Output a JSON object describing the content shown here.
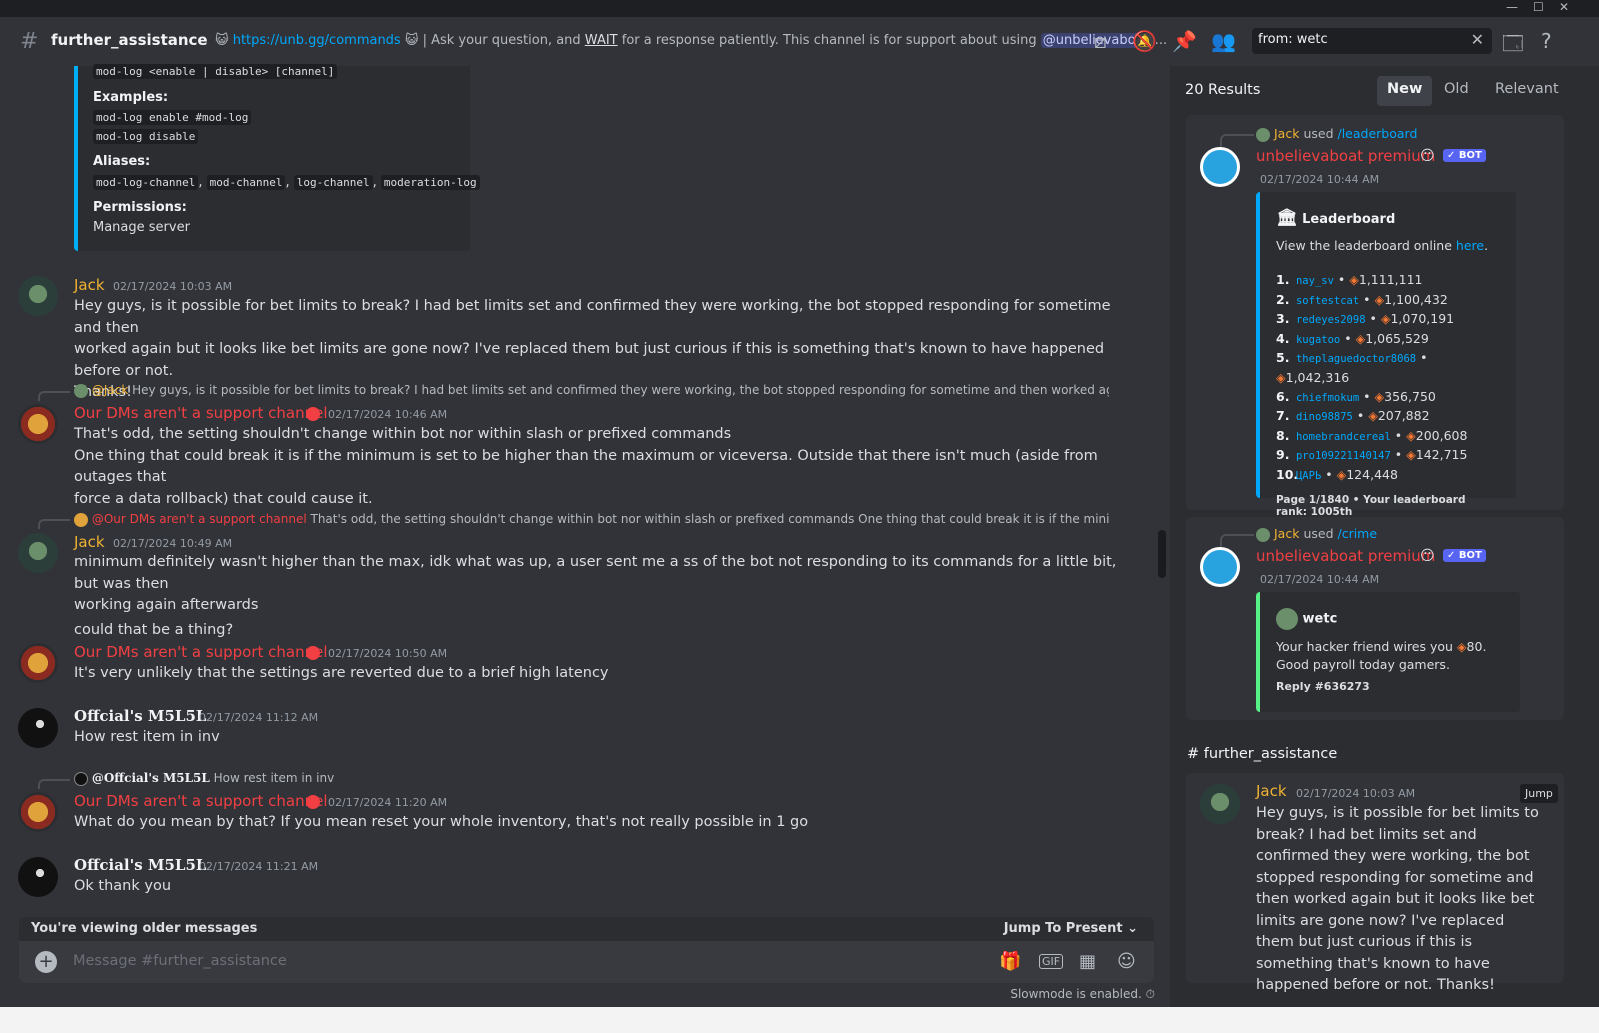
{
  "header": {
    "channel": "further_assistance",
    "topic_link": "https://unb.gg/commands",
    "topic_a": "| Ask your question, and ",
    "topic_wait": "WAIT",
    "topic_b": " for a response patiently. This channel is for support about using ",
    "topic_mention": "@unbelievaboat",
    "topic_more": "...",
    "search_value": "from: wetc"
  },
  "embed_top": {
    "syntax": "mod-log <enable | disable> [channel]",
    "examples_label": "Examples:",
    "example1": "mod-log enable #mod-log",
    "example2": "mod-log disable",
    "aliases_label": "Aliases:",
    "alias1": "mod-log-channel",
    "alias2": "mod-channel",
    "alias3": "log-channel",
    "alias4": "moderation-log",
    "permissions_label": "Permissions:",
    "permissions_value": "Manage server"
  },
  "messages": [
    {
      "author": "Jack",
      "time": "02/17/2024 10:03 AM",
      "text1": "Hey guys, is it possible for bet limits to break? I had bet limits set and confirmed they were working, the bot stopped responding for sometime and then",
      "text2": "worked again but it looks like bet limits are gone now? I've replaced them but just curious if this is something that's known to have happened before or not.",
      "text3": "Thanks!"
    },
    {
      "reply_to": "@Jack",
      "reply_text": "Hey guys, is it possible for bet limits to break? I had bet limits set and confirmed they were working, the bot stopped responding for sometime and then worked again bu",
      "author": "Our DMs aren't a support channel",
      "time": "02/17/2024 10:46 AM",
      "text1": "That's odd, the setting shouldn't change within bot nor within slash or prefixed commands",
      "text2": "One thing that could break it is if the minimum is set to be higher than the maximum or viceversa. Outside that there isn't much (aside from outages that",
      "text3": "force a data rollback) that could cause it."
    },
    {
      "reply_to": "@Our DMs aren't a support channel",
      "reply_text": "That's odd, the setting shouldn't change within bot nor within slash or prefixed commands One thing that could break it is if the minimum i",
      "author": "Jack",
      "time": "02/17/2024 10:49 AM",
      "text1": "minimum definitely wasn't higher than the max, idk what was up, a user sent me a ss of the bot not responding to its commands for a little bit, but was then",
      "text2": "working again afterwards",
      "text3": "could that be a thing?"
    },
    {
      "author": "Our DMs aren't a support channel",
      "time": "02/17/2024 10:50 AM",
      "text1": "It's very unlikely that the settings are reverted due to a brief high latency"
    },
    {
      "author": "Offcial's M5L5L",
      "time": "02/17/2024 11:12 AM",
      "text1": "How rest item in inv"
    },
    {
      "reply_to": "@Offcial's M5L5L",
      "reply_text": "How rest item in inv",
      "author": "Our DMs aren't a support channel",
      "time": "02/17/2024 11:20 AM",
      "text1": "What do you mean by that? If you mean reset your whole inventory, that's not really possible in 1 go"
    },
    {
      "author": "Offcial's M5L5L",
      "time": "02/17/2024 11:21 AM",
      "text1": "Ok thank you"
    }
  ],
  "older_bar": {
    "label": "You're viewing older messages",
    "jump": "Jump To Present"
  },
  "composer": {
    "placeholder": "Message #further_assistance",
    "slowmode": "Slowmode is enabled."
  },
  "search_panel": {
    "count": "20 Results",
    "tabs": [
      "New",
      "Old",
      "Relevant"
    ],
    "r1": {
      "user": "Jack",
      "used": "used",
      "cmd": "/leaderboard",
      "bot": "unbelievaboat premium",
      "badge": "✓ BOT",
      "time": "02/17/2024 10:44 AM",
      "title": "Leaderboard",
      "desc": "View the leaderboard online ",
      "here": "here",
      "rows": [
        {
          "rank": "1.",
          "user": "nay_sv",
          "value": "1,111,111"
        },
        {
          "rank": "2.",
          "user": "softestcat",
          "value": "1,100,432"
        },
        {
          "rank": "3.",
          "user": "redeyes2098",
          "value": "1,070,191"
        },
        {
          "rank": "4.",
          "user": "kugatoo",
          "value": "1,065,529"
        },
        {
          "rank": "5.",
          "user": "theplaguedoctor8068",
          "value": "1,042,316"
        },
        {
          "rank": "6.",
          "user": "chiefmokum",
          "value": "356,750"
        },
        {
          "rank": "7.",
          "user": "dino98875",
          "value": "207,882"
        },
        {
          "rank": "8.",
          "user": "homebrandcereal",
          "value": "200,608"
        },
        {
          "rank": "9.",
          "user": "pro109221140147",
          "value": "142,715"
        },
        {
          "rank": "10.",
          "user": "ЦАРЬ",
          "value": "124,448"
        }
      ],
      "footer": "Page 1/1840 • Your leaderboard rank: 1005th"
    },
    "r2": {
      "user": "Jack",
      "used": "used",
      "cmd": "/crime",
      "bot": "unbelievaboat premium",
      "badge": "✓ BOT",
      "time": "02/17/2024 10:44 AM",
      "author": "wetc",
      "text_a": "Your hacker friend wires you ",
      "text_b": "80. Good payroll today gamers.",
      "footer": "Reply #636273"
    },
    "r3": {
      "channel": "# further_assistance",
      "user": "Jack",
      "time": "02/17/2024 10:03 AM",
      "jump": "Jump",
      "text": "Hey guys, is it possible for bet limits to break? I had bet limits set and confirmed they were working, the bot stopped responding for sometime and then worked again but it looks like bet limits are gone now? I've replaced them but just curious if this is something that's known to have happened before or not. Thanks!"
    }
  }
}
